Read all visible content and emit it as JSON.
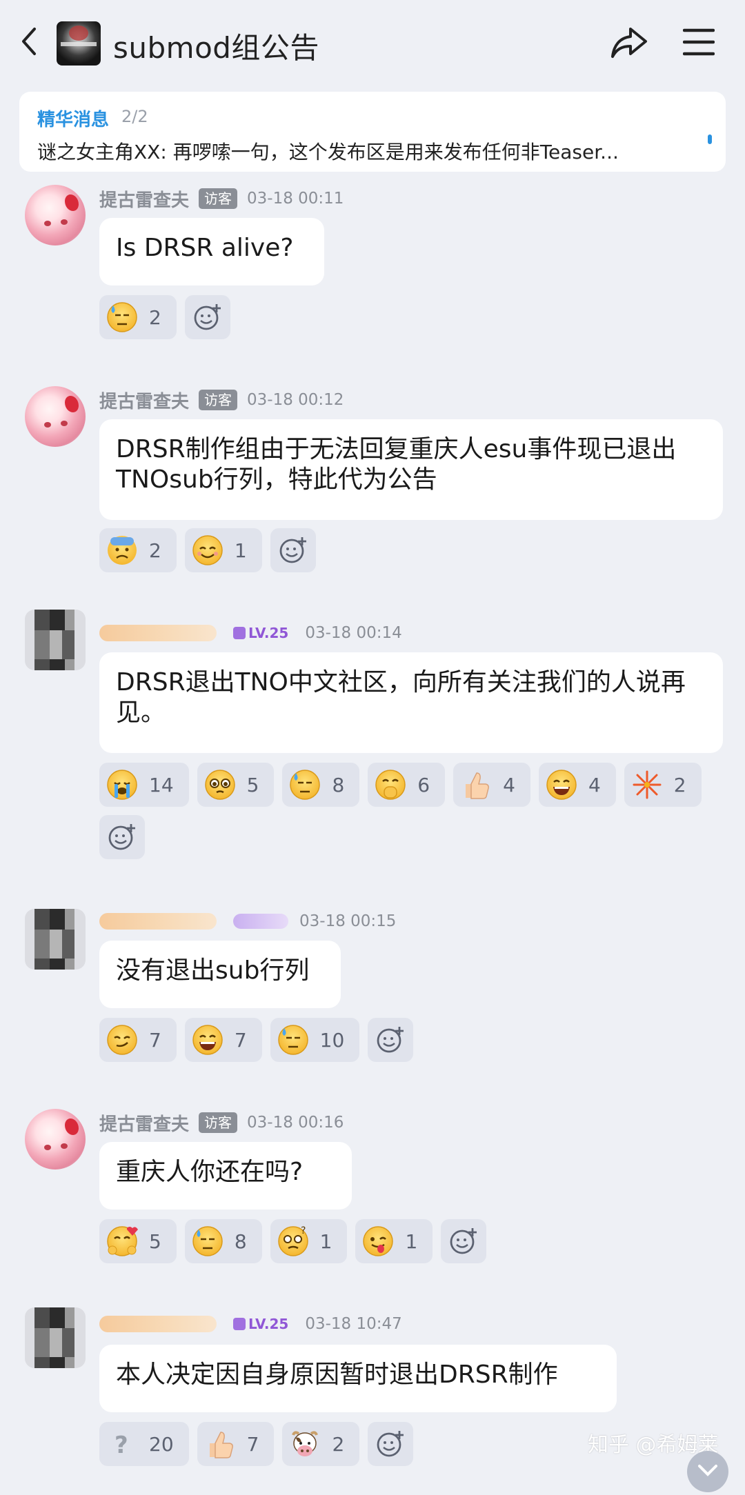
{
  "header": {
    "title": "submod组公告",
    "back_icon": "chevron-left-icon",
    "share_icon": "share-icon",
    "menu_icon": "menu-icon"
  },
  "pinned": {
    "label": "精华消息",
    "count": "2/2",
    "text": "谜之女主角XX: 再啰嗦一句，这个发布区是用来发布任何非Teaser..."
  },
  "messages": [
    {
      "name": "提古雷查夫",
      "badge": "访客",
      "time": "03-18 00:11",
      "text": "Is DRSR alive?",
      "reactions": [
        {
          "emoji": "sweat-face",
          "count": "2"
        }
      ]
    },
    {
      "name": "提古雷查夫",
      "badge": "访客",
      "time": "03-18 00:12",
      "text": "DRSR制作组由于无法回复重庆人esu事件现已退出TNOsub行列，特此代为公告",
      "reactions": [
        {
          "emoji": "anxious-sweat-face",
          "count": "2"
        },
        {
          "emoji": "smiling-face",
          "count": "1"
        }
      ]
    },
    {
      "name": "",
      "level": "LV.25",
      "time": "03-18 00:14",
      "text": "DRSR退出TNO中文社区，向所有关注我们的人说再见。",
      "reactions": [
        {
          "emoji": "crying-face",
          "count": "14"
        },
        {
          "emoji": "pleading-face",
          "count": "5"
        },
        {
          "emoji": "sweat-face",
          "count": "8"
        },
        {
          "emoji": "hand-over-mouth-face",
          "count": "6"
        },
        {
          "emoji": "thumbs-up",
          "count": "4"
        },
        {
          "emoji": "grinning-face",
          "count": "4"
        },
        {
          "emoji": "fireworks",
          "count": "2"
        }
      ]
    },
    {
      "name": "",
      "level": "",
      "time": "03-18 00:15",
      "text": "没有退出sub行列",
      "reactions": [
        {
          "emoji": "smirk-face",
          "count": "7"
        },
        {
          "emoji": "grinning-face",
          "count": "7"
        },
        {
          "emoji": "sweat-face",
          "count": "10"
        }
      ]
    },
    {
      "name": "提古雷查夫",
      "badge": "访客",
      "time": "03-18 00:16",
      "text": "重庆人你还在吗?",
      "reactions": [
        {
          "emoji": "hugging-face",
          "count": "5"
        },
        {
          "emoji": "sweat-face",
          "count": "8"
        },
        {
          "emoji": "thinking-face",
          "count": "1"
        },
        {
          "emoji": "winking-tongue-face",
          "count": "1"
        }
      ]
    },
    {
      "name": "",
      "level": "LV.25",
      "time": "03-18 10:47",
      "text": "本人决定因自身原因暂时退出DRSR制作",
      "reactions": [
        {
          "emoji": "question-mark",
          "count": "20"
        },
        {
          "emoji": "thumbs-up",
          "count": "7"
        },
        {
          "emoji": "cow-face",
          "count": "2"
        }
      ]
    }
  ],
  "watermark": "知乎 @希姆莱",
  "colors": {
    "accent": "#2a92e0",
    "background": "#eef0f5",
    "bubble": "#ffffff",
    "reaction_bg": "#e0e3ec",
    "level": "#9057d6"
  }
}
